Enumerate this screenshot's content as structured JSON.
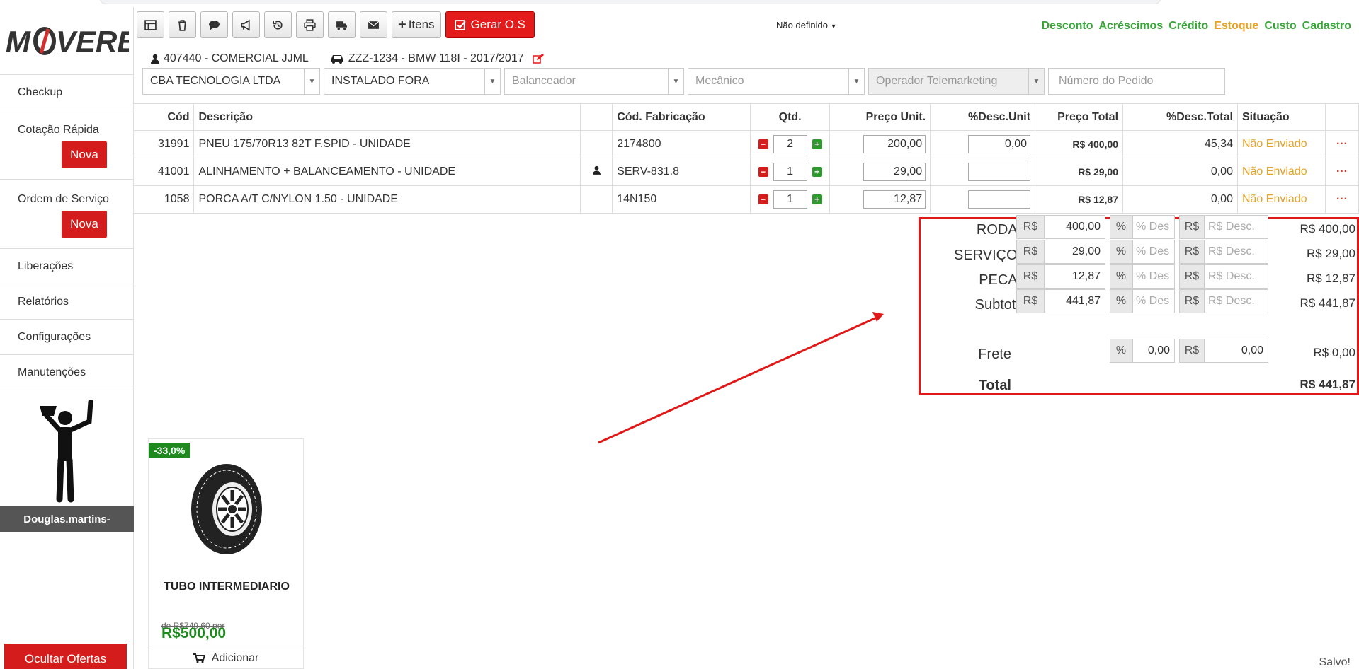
{
  "toolbar": {
    "itens_label": "Itens",
    "gerar_label": "Gerar O.S"
  },
  "status_dropdown": "Não definido",
  "top_links": {
    "desconto": "Desconto",
    "acrescimos": "Acréscimos",
    "credito": "Crédito",
    "estoque": "Estoque",
    "custo": "Custo",
    "cadastro": "Cadastro"
  },
  "info": {
    "client": "407440 - COMERCIAL JJML",
    "vehicle": "ZZZ-1234 - BMW 118I - 2017/2017"
  },
  "selects": {
    "empresa": "CBA TECNOLOGIA LTDA",
    "instalacao": "INSTALADO FORA",
    "balanceador": "Balanceador",
    "mecanico": "Mecânico",
    "operador": "Operador Telemarketing",
    "pedido_placeholder": "Número do Pedido"
  },
  "sidebar": {
    "logo": "MOVERE",
    "checkup": "Checkup",
    "cotacao": "Cotação Rápida",
    "cotacao_badge": "Nova",
    "ordem": "Ordem de Serviço",
    "ordem_badge": "Nova",
    "liberacoes": "Liberações",
    "relatorios": "Relatórios",
    "configuracoes": "Configurações",
    "manutencoes": "Manutenções",
    "user": "Douglas.martins-",
    "ocultar": "Ocultar Ofertas"
  },
  "table": {
    "headers": {
      "cod": "Cód",
      "descricao": "Descrição",
      "cod_fab": "Cód. Fabricação",
      "qtd": "Qtd.",
      "preco_unit": "Preço Unit.",
      "desc_unit": "%Desc.Unit",
      "preco_total": "Preço Total",
      "desc_total": "%Desc.Total",
      "situacao": "Situação"
    },
    "rows": [
      {
        "cod": "31991",
        "desc": "PNEU 175/70R13 82T F.SPID - UNIDADE",
        "fab": "2174800",
        "qtd": "2",
        "preco": "200,00",
        "desc_unit": "0,00",
        "total": "R$ 400,00",
        "desc_total": "45,34",
        "situacao": "Não Enviado"
      },
      {
        "cod": "41001",
        "desc": "ALINHAMENTO + BALANCEAMENTO - UNIDADE",
        "fab": "SERV-831.8",
        "qtd": "1",
        "preco": "29,00",
        "desc_unit": "",
        "total": "R$ 29,00",
        "desc_total": "0,00",
        "situacao": "Não Enviado"
      },
      {
        "cod": "1058",
        "desc": "PORCA A/T C/NYLON 1.50 - UNIDADE",
        "fab": "14N150",
        "qtd": "1",
        "preco": "12,87",
        "desc_unit": "",
        "total": "R$ 12,87",
        "desc_total": "0,00",
        "situacao": "Não Enviado"
      }
    ]
  },
  "totals": {
    "rs": "R$",
    "pct": "%",
    "pct_ph": "% Des",
    "rs_ph": "R$ Desc.",
    "rows": [
      {
        "label": "RODAS",
        "value": "400,00",
        "total": "R$ 400,00"
      },
      {
        "label": "SERVIÇOS",
        "value": "29,00",
        "total": "R$ 29,00"
      },
      {
        "label": "PECAS",
        "value": "12,87",
        "total": "R$ 12,87"
      },
      {
        "label": "Subtotal",
        "value": "441,87",
        "total": "R$ 441,87"
      }
    ],
    "frete_label": "Frete",
    "frete_pct": "0,00",
    "frete_rs": "0,00",
    "frete_total": "R$ 0,00",
    "total_label": "Total",
    "total_value": "R$ 441,87"
  },
  "offer": {
    "badge": "-33,0%",
    "title": "TUBO INTERMEDIARIO",
    "old_price": "de R$749,60 por",
    "price": "R$500,00",
    "add_label": "Adicionar"
  },
  "saved": "Salvo!",
  "colors": {
    "accent_red": "#e31b1b",
    "green": "#3aa63a",
    "orange": "#e6a325"
  }
}
